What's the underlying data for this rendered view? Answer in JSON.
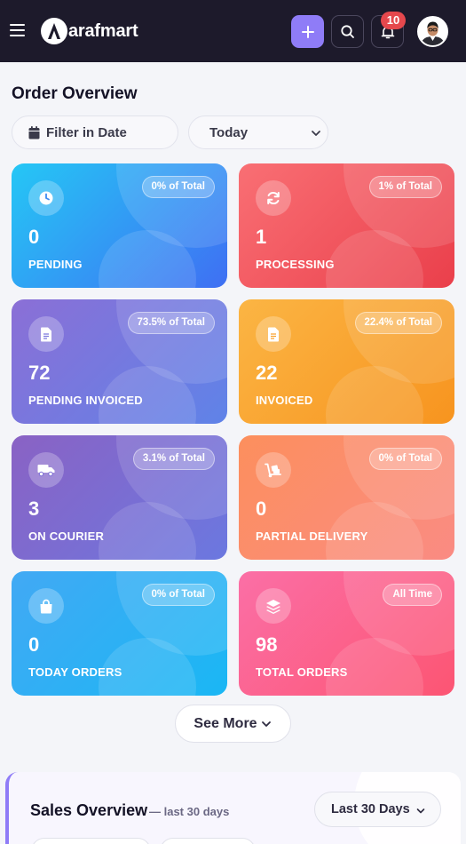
{
  "header": {
    "logo_text": "arafmart",
    "notification_count": "10",
    "colors": {
      "bar": "#1d1a2b",
      "accent": "#8f7cf7",
      "badge": "#e5484d"
    }
  },
  "order_overview": {
    "title": "Order Overview",
    "filter_label": "Filter in Date",
    "period_selected": "Today"
  },
  "cards": [
    {
      "count": "0",
      "label": "PENDING",
      "badge": "0% of Total",
      "icon": "clock-icon"
    },
    {
      "count": "1",
      "label": "PROCESSING",
      "badge": "1% of Total",
      "icon": "refresh-icon"
    },
    {
      "count": "72",
      "label": "PENDING INVOICED",
      "badge": "73.5% of Total",
      "icon": "document-icon"
    },
    {
      "count": "22",
      "label": "INVOICED",
      "badge": "22.4% of Total",
      "icon": "document-icon"
    },
    {
      "count": "3",
      "label": "ON COURIER",
      "badge": "3.1% of Total",
      "icon": "truck-icon"
    },
    {
      "count": "0",
      "label": "PARTIAL DELIVERY",
      "badge": "0% of Total",
      "icon": "dolly-icon"
    },
    {
      "count": "0",
      "label": "TODAY ORDERS",
      "badge": "0% of Total",
      "icon": "shopping-bag-icon"
    },
    {
      "count": "98",
      "label": "TOTAL ORDERS",
      "badge": "All Time",
      "icon": "layers-icon"
    }
  ],
  "see_more_label": "See More",
  "sales_overview": {
    "title": "Sales Overview",
    "subtitle": "— last 30 days",
    "period_selected": "Last 30 Days"
  }
}
